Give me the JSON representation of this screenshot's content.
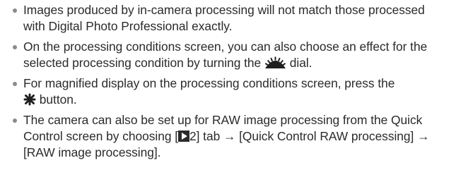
{
  "notes": [
    {
      "text": "Images produced by in-camera processing will not match those processed with Digital Photo Professional exactly."
    },
    {
      "text_before": "On the processing conditions screen, you can also choose an effect for the selected processing condition by turning the",
      "icon": "main-dial-icon",
      "text_after": "dial."
    },
    {
      "text_before": "For magnified display on the processing conditions screen, press the",
      "icon": "magnify-asterisk-icon",
      "text_after": "button."
    },
    {
      "text_before": "The camera can also be set up for RAW image processing from the Quick Control screen by choosing [",
      "icon": "playback-icon",
      "text_after": "2] tab → [Quick Control RAW processing] → [RAW image processing]."
    }
  ]
}
